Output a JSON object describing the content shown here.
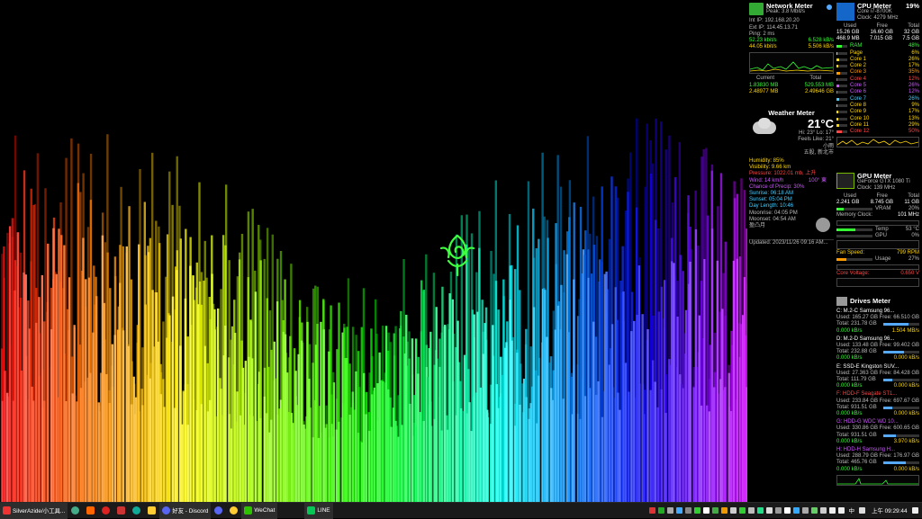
{
  "network": {
    "title": "Network Meter",
    "peak": "Peak: 3.8 Mbit/s",
    "int_ip": "Int IP: 192.168.20.20",
    "ext_ip": "Ext IP: 114.45.13.71",
    "ping": "Ping: 2 ms",
    "up_kbit": "52.23 kbit/s",
    "up_kbs": "6.528 kB/s",
    "down_kbit": "44.05 kbit/s",
    "down_kbs": "5.506 kB/s",
    "current_label": "Current",
    "total_label": "Total",
    "cur_up": "1.83830 MB",
    "tot_up": "529.553 MB",
    "cur_down": "2.48977 MB",
    "tot_down": "2.49646 GB"
  },
  "weather": {
    "title": "Weather Meter",
    "temp": "21°C",
    "hilo": "Hi: 23°  Lo: 17°",
    "feels": "Feels Like: 21°",
    "cond": "小雨",
    "location": "五股, 新北市",
    "humidity": "Humidity: 85%",
    "visibility": "Visibility: 9.66 km",
    "pressure": "Pressure: 1022.01 mb, 上升",
    "wind": "Wind: 14 km/h",
    "wind_dir": "100° 東",
    "precip": "Chance of Precip: 30%",
    "sunrise": "Sunrise: 06:18 AM",
    "sunset": "Sunset: 05:04 PM",
    "day_length": "Day Length: 10:46",
    "moonrise": "Moonrise: 04:05 PM",
    "moonset": "Moonset: 04:54 AM",
    "moon_phase": "盈凸月",
    "updated": "Updated: 2023/11/26 09:16 AM..."
  },
  "cpu": {
    "title": "CPU Meter",
    "pct": "19%",
    "model": "Core i7-8700K",
    "clock": "Clock: 4279 MHz",
    "h_used": "Used",
    "h_free": "Free",
    "h_total": "Total",
    "ram_used": "15.26 GB",
    "ram_free": "16.60 GB",
    "ram_total": "32 GB",
    "page_used": "468.9 MB",
    "page_free": "7.015 GB",
    "page_total": "7.5 GB",
    "rows": [
      {
        "name": "RAM",
        "pct": "48%",
        "val": 48,
        "color": "#3f3"
      },
      {
        "name": "Page",
        "pct": "6%",
        "val": 6,
        "color": "#ffd700"
      },
      {
        "name": "Core 1",
        "pct": "26%",
        "val": 26,
        "color": "#ffd700"
      },
      {
        "name": "Core 2",
        "pct": "17%",
        "val": 17,
        "color": "#ffd700"
      },
      {
        "name": "Core 3",
        "pct": "35%",
        "val": 35,
        "color": "#ff9900"
      },
      {
        "name": "Core 4",
        "pct": "12%",
        "val": 12,
        "color": "#ff4444"
      },
      {
        "name": "Core 5",
        "pct": "26%",
        "val": 26,
        "color": "#cc55ff"
      },
      {
        "name": "Core 6",
        "pct": "12%",
        "val": 12,
        "color": "#cc55ff"
      },
      {
        "name": "Core 7",
        "pct": "26%",
        "val": 26,
        "color": "#44ccff"
      },
      {
        "name": "Core 8",
        "pct": "9%",
        "val": 9,
        "color": "#ffd700"
      },
      {
        "name": "Core 9",
        "pct": "17%",
        "val": 17,
        "color": "#ffd700"
      },
      {
        "name": "Core 10",
        "pct": "13%",
        "val": 13,
        "color": "#ffd700"
      },
      {
        "name": "Core 11",
        "pct": "29%",
        "val": 29,
        "color": "#ffd700"
      },
      {
        "name": "Core 12",
        "pct": "50%",
        "val": 50,
        "color": "#ff4444"
      }
    ]
  },
  "gpu": {
    "title": "GPU Meter",
    "model": "GeForce GTX 1080 Ti",
    "clock": "Clock: 139 MHz",
    "h_used": "Used",
    "h_free": "Free",
    "h_total": "Total",
    "used": "2.241 GB",
    "free": "8.745 GB",
    "total": "11 GB",
    "vram_label": "VRAM",
    "vram_pct": "20%",
    "mem_clock_label": "Memory Clock:",
    "mem_clock": "101 MHz",
    "temp_label": "Temp",
    "temp": "53 °C",
    "gpu_label": "GPU",
    "gpu_pct": "0%",
    "fan_label": "Fan Speed:",
    "fan": "799 RPM",
    "usage_label": "Usage",
    "usage": "27%",
    "voltage_label": "Core Voltage:",
    "voltage": "0.650 V"
  },
  "drives": {
    "title": "Drives Meter",
    "items": [
      {
        "name": "C: M.2-C  Samsung 96...",
        "used": "Used: 165.27 GB",
        "free": "Free: 66.510 GB",
        "total": "Total: 231.78 GB",
        "r": "0.000 kB/s",
        "w": "1.504 MB/s",
        "color": "#fff",
        "fill": 71
      },
      {
        "name": "D: M.2-D  Samsung 96...",
        "used": "Used: 133.48 GB",
        "free": "Free: 99.402 GB",
        "total": "Total: 232.88 GB",
        "r": "0.000 kB/s",
        "w": "0.000 kB/s",
        "color": "#fff",
        "fill": 57
      },
      {
        "name": "E: SSD-E  Kingston SUV...",
        "used": "Used: 27.363 GB",
        "free": "Free: 84.428 GB",
        "total": "Total: 111.79 GB",
        "r": "0.000 kB/s",
        "w": "0.000 kB/s",
        "color": "#fff",
        "fill": 24
      },
      {
        "name": "F: HDD-F  Seagate ST1...",
        "used": "Used: 233.84 GB",
        "free": "Free: 697.67 GB",
        "total": "Total: 931.51 GB",
        "r": "0.000 kB/s",
        "w": "0.000 kB/s",
        "color": "#f44",
        "fill": 25
      },
      {
        "name": "G: HDD-G  WDC WD 10...",
        "used": "Used: 330.86 GB",
        "free": "Free: 600.65 GB",
        "total": "Total: 931.51 GB",
        "r": "0.000 kB/s",
        "w": "3.970 kB/s",
        "color": "#c5f",
        "fill": 36
      },
      {
        "name": "H: HDD-H  Samsung H...",
        "used": "Used: 288.79 GB",
        "free": "Free: 176.97 GB",
        "total": "Total: 465.76 GB",
        "r": "0.000 kB/s",
        "w": "0.000 kB/s",
        "color": "#c5f",
        "fill": 62
      }
    ]
  },
  "taskbar": {
    "app1": "SilverAzide/小工具...",
    "discord": "好友 - Discord",
    "wechat": "WeChat",
    "line": "LINE",
    "ime": "中",
    "time": "上午 09:29:44"
  }
}
